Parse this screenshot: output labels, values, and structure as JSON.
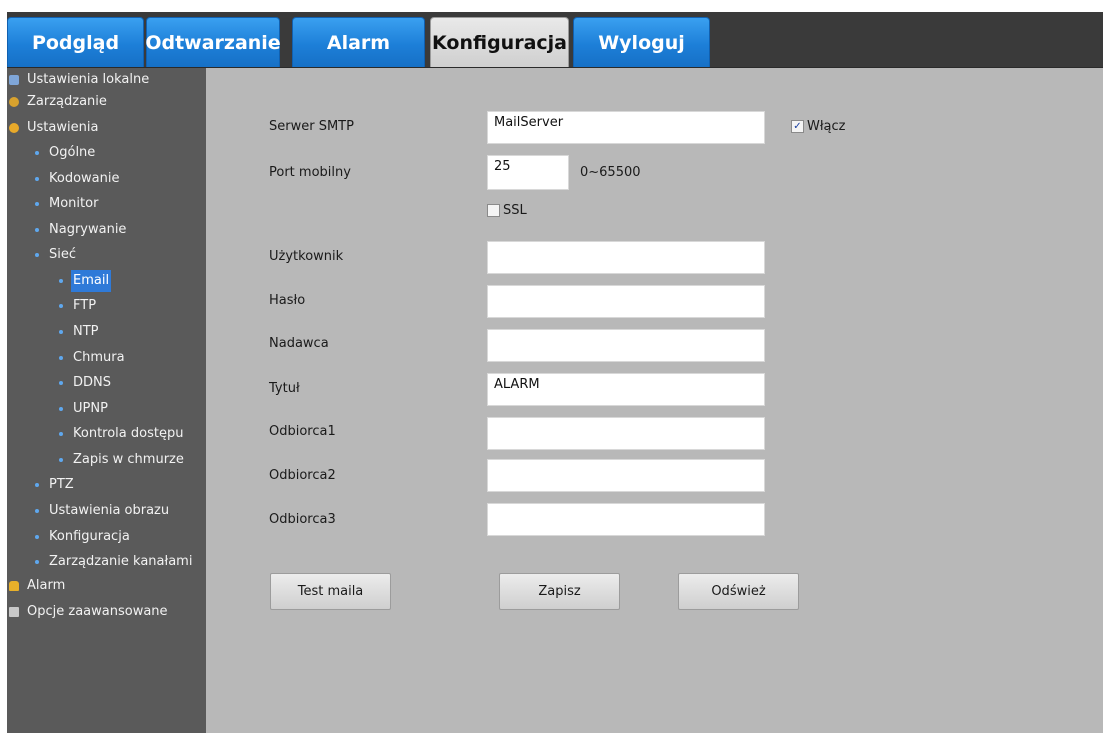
{
  "tabs": {
    "preview": "Podgląd",
    "playback": "Odtwarzanie",
    "alarm": "Alarm",
    "config": "Konfiguracja",
    "logout": "Wyloguj"
  },
  "sidebar": {
    "local_settings": "Ustawienia lokalne",
    "management": "Zarządzanie",
    "settings": "Ustawienia",
    "general": "Ogólne",
    "encoding": "Kodowanie",
    "monitor": "Monitor",
    "recording": "Nagrywanie",
    "network": "Sieć",
    "email": "Email",
    "ftp": "FTP",
    "ntp": "NTP",
    "cloud": "Chmura",
    "ddns": "DDNS",
    "upnp": "UPNP",
    "access_control": "Kontrola dostępu",
    "cloud_record": "Zapis w chmurze",
    "ptz": "PTZ",
    "image_settings": "Ustawienia obrazu",
    "configuration": "Konfiguracja",
    "channel_mgmt": "Zarządzanie kanałami",
    "alarm": "Alarm",
    "advanced": "Opcje zaawansowane"
  },
  "form": {
    "smtp_server_label": "Serwer SMTP",
    "smtp_server_value": "MailServer",
    "enable_label": "Włącz",
    "enable_checked": true,
    "port_label": "Port mobilny",
    "port_value": "25",
    "port_range": "0~65500",
    "ssl_label": "SSL",
    "ssl_checked": false,
    "user_label": "Użytkownik",
    "user_value": "",
    "password_label": "Hasło",
    "password_value": "",
    "sender_label": "Nadawca",
    "sender_value": "",
    "title_label": "Tytuł",
    "title_value": "ALARM",
    "recipient1_label": "Odbiorca1",
    "recipient1_value": "",
    "recipient2_label": "Odbiorca2",
    "recipient2_value": "",
    "recipient3_label": "Odbiorca3",
    "recipient3_value": ""
  },
  "buttons": {
    "test_mail": "Test maila",
    "save": "Zapisz",
    "refresh": "Odśwież"
  },
  "colors": {
    "tab_blue": "#1d7fd8",
    "sidebar_bg": "#5a5a5a",
    "selected": "#2f7ad8",
    "content_bg": "#b8b8b8"
  }
}
